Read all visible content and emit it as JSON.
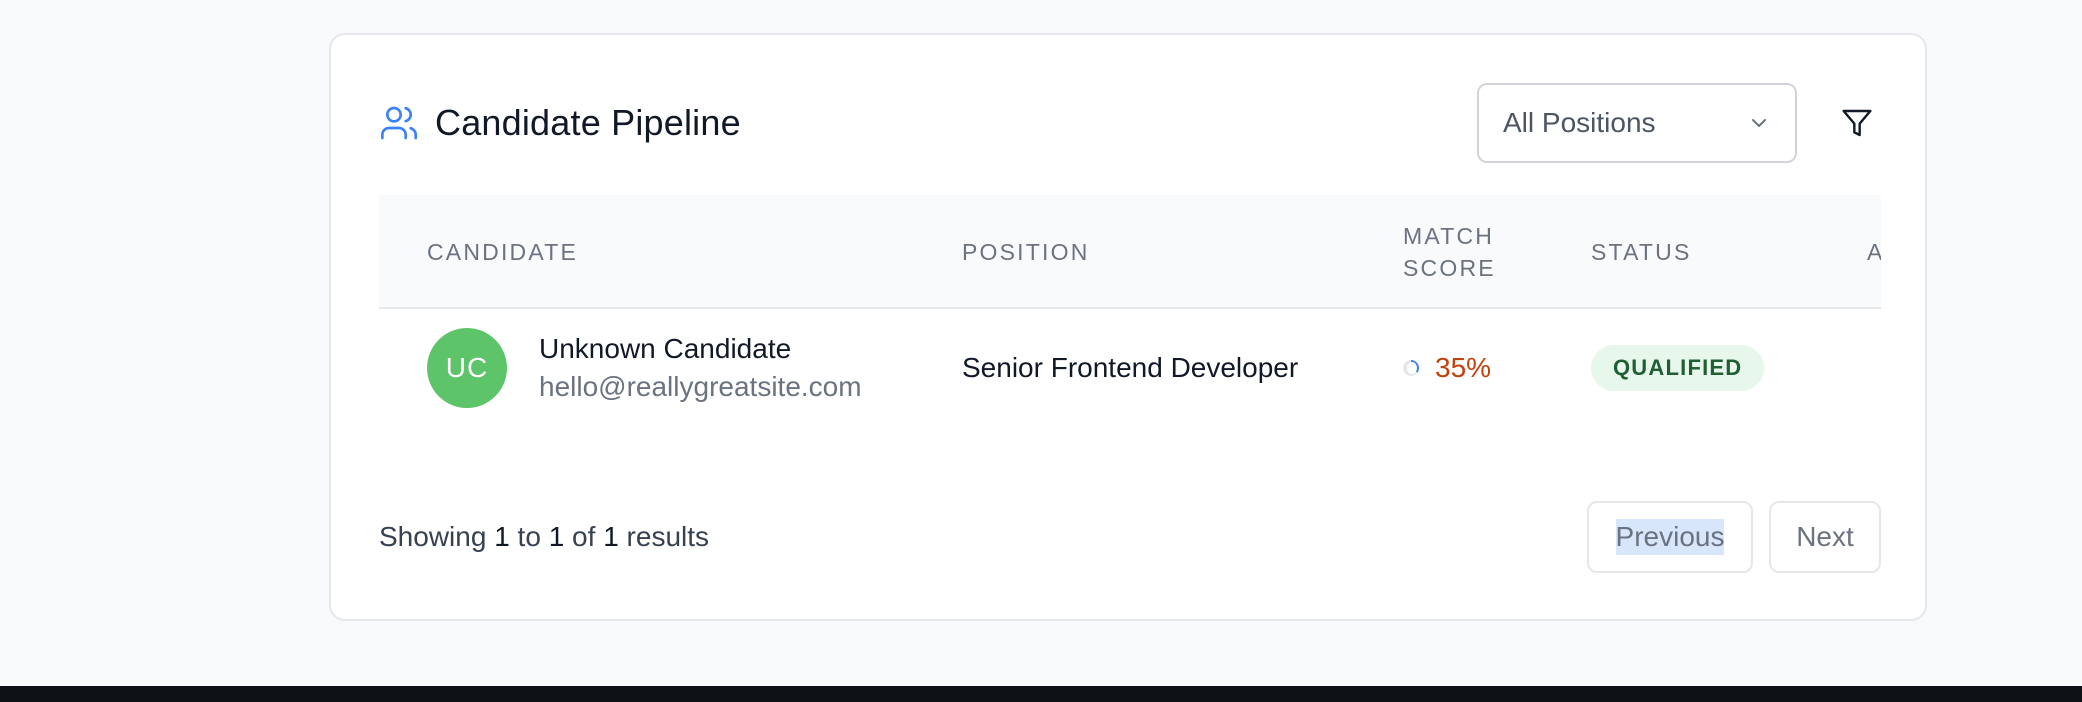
{
  "card": {
    "title": "Candidate Pipeline",
    "title_icon": "users-icon",
    "accent_color": "#3b82f6"
  },
  "filters": {
    "position_select_value": "All Positions",
    "filter_icon": "filter-icon"
  },
  "table": {
    "columns": [
      "CANDIDATE",
      "POSITION",
      "MATCH SCORE",
      "STATUS",
      "A"
    ],
    "rows": [
      {
        "initials": "UC",
        "name": "Unknown Candidate",
        "email": "hello@reallygreatsite.com",
        "position": "Senior Frontend Developer",
        "match_score": "35%",
        "match_score_value": 35,
        "status": "QUALIFIED",
        "avatar_color": "#5dc46a",
        "status_color": "#e8f7ec"
      }
    ]
  },
  "footer": {
    "showing_prefix": "Showing",
    "from": "1",
    "to_word": "to",
    "to": "1",
    "of_word": "of",
    "total": "1",
    "results_word": "results",
    "previous_label": "Previous",
    "next_label": "Next"
  }
}
